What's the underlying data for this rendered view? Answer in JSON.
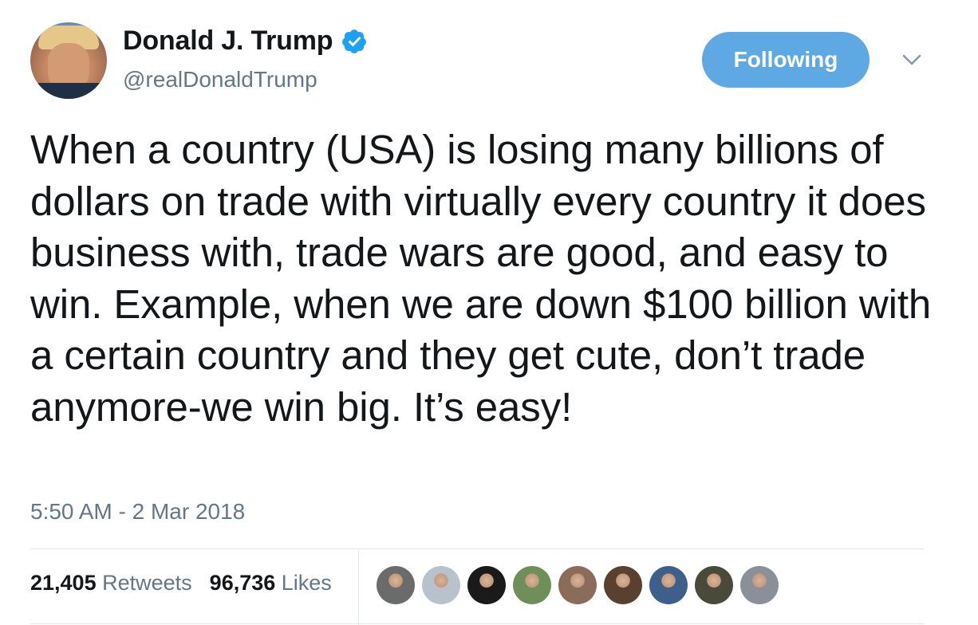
{
  "author": {
    "display_name": "Donald J. Trump",
    "handle": "@realDonaldTrump",
    "verified_icon": "verified-badge-icon",
    "verified_color": "#1da1f2"
  },
  "follow_button": {
    "label": "Following",
    "color": "#5ea9e3"
  },
  "menu_icon": "chevron-down-icon",
  "tweet": {
    "text": "When a country (USA) is losing many billions of dollars on trade with virtually every country it does business with, trade wars are good, and easy to win. Example, when we are down $100 billion with a certain country and they get cute, don’t trade anymore-we win big. It’s easy!",
    "timestamp": "5:50 AM - 2 Mar 2018"
  },
  "stats": {
    "retweets_count": "21,405",
    "retweets_label": "Retweets",
    "likes_count": "96,736",
    "likes_label": "Likes"
  },
  "likers": [
    {
      "name": "liker-avatar-1",
      "color": "#6b6b6b"
    },
    {
      "name": "liker-avatar-2",
      "color": "#b8c2cc"
    },
    {
      "name": "liker-avatar-3",
      "color": "#1a1a1a"
    },
    {
      "name": "liker-avatar-4",
      "color": "#6e8f5a"
    },
    {
      "name": "liker-avatar-5",
      "color": "#8b6b5a"
    },
    {
      "name": "liker-avatar-6",
      "color": "#5a4030"
    },
    {
      "name": "liker-avatar-7",
      "color": "#3d5f8a"
    },
    {
      "name": "liker-avatar-8",
      "color": "#4a4a3a"
    },
    {
      "name": "liker-avatar-9",
      "color": "#8a8f99"
    }
  ]
}
